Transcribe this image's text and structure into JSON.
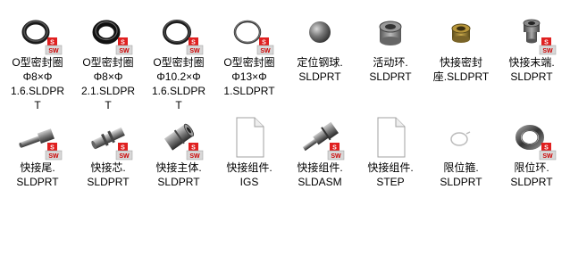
{
  "files": [
    {
      "name": "O型密封圈Φ8×Φ1.6.SLDPRT",
      "lines": [
        "O型密封圈",
        "Φ8×Φ",
        "1.6.SLDPR",
        "T"
      ],
      "icon": "o-ring-part-icon",
      "swbadge": true
    },
    {
      "name": "O型密封圈Φ8×Φ2.1.SLDPRT",
      "lines": [
        "O型密封圈",
        "Φ8×Φ",
        "2.1.SLDPR",
        "T"
      ],
      "icon": "o-ring-thick-part-icon",
      "swbadge": true
    },
    {
      "name": "O型密封圈Φ10.2×Φ1.6.SLDPRT",
      "lines": [
        "O型密封圈",
        "Φ10.2×Φ",
        "1.6.SLDPR",
        "T"
      ],
      "icon": "o-ring-large-part-icon",
      "swbadge": true
    },
    {
      "name": "O型密封圈Φ13×Φ1.SLDPRT",
      "lines": [
        "O型密封圈",
        "Φ13×Φ",
        "1.SLDPRT"
      ],
      "icon": "o-ring-thin-part-icon",
      "swbadge": true
    },
    {
      "name": "定位钢球.SLDPRT",
      "lines": [
        "定位钢球.",
        "SLDPRT"
      ],
      "icon": "steel-ball-part-icon",
      "swbadge": false
    },
    {
      "name": "活动环.SLDPRT",
      "lines": [
        "活动环.",
        "SLDPRT"
      ],
      "icon": "sleeve-ring-part-icon",
      "swbadge": false
    },
    {
      "name": "快接密封座.SLDPRT",
      "lines": [
        "快接密封",
        "座.SLDPRT"
      ],
      "icon": "brass-seat-part-icon",
      "swbadge": false
    },
    {
      "name": "快接末端.SLDPRT",
      "lines": [
        "快接末端.",
        "SLDPRT"
      ],
      "icon": "end-fitting-part-icon",
      "swbadge": true
    },
    {
      "name": "快接尾.SLDPRT",
      "lines": [
        "快接尾.",
        "SLDPRT"
      ],
      "icon": "tail-fitting-part-icon",
      "swbadge": true
    },
    {
      "name": "快接芯.SLDPRT",
      "lines": [
        "快接芯.",
        "SLDPRT"
      ],
      "icon": "core-fitting-part-icon",
      "swbadge": true
    },
    {
      "name": "快接主体.SLDPRT",
      "lines": [
        "快接主体.",
        "SLDPRT"
      ],
      "icon": "body-fitting-part-icon",
      "swbadge": true
    },
    {
      "name": "快接组件.IGS",
      "lines": [
        "快接组件.",
        "IGS"
      ],
      "icon": "blank-document-icon",
      "swbadge": false
    },
    {
      "name": "快接组件.SLDASM",
      "lines": [
        "快接组件.",
        "SLDASM"
      ],
      "icon": "assembly-fitting-icon",
      "swbadge": true
    },
    {
      "name": "快接组件.STEP",
      "lines": [
        "快接组件.",
        "STEP"
      ],
      "icon": "blank-document-icon",
      "swbadge": false
    },
    {
      "name": "限位箍.SLDPRT",
      "lines": [
        "限位箍.",
        "SLDPRT"
      ],
      "icon": "retaining-clip-part-icon",
      "swbadge": false
    },
    {
      "name": "限位环.SLDPRT",
      "lines": [
        "限位环.",
        "SLDPRT"
      ],
      "icon": "retaining-ring-part-icon",
      "swbadge": true
    }
  ]
}
